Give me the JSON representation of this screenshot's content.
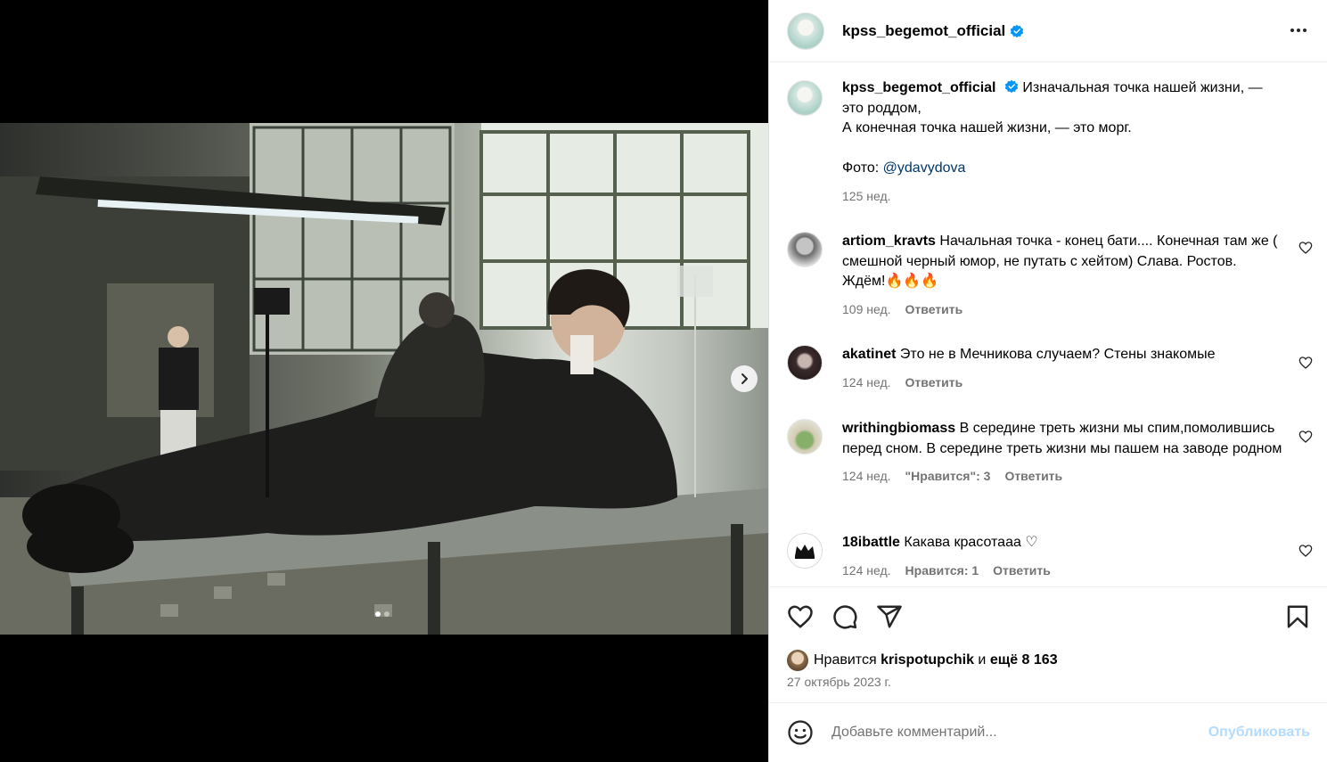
{
  "post": {
    "username": "kpss_begemot_official",
    "verified": true
  },
  "caption": {
    "username": "kpss_begemot_official",
    "line1": "Изначальная точка нашей жизни, —",
    "line2": "это роддом,",
    "line3": "А конечная точка нашей жизни, — это морг.",
    "photo_label": "Фото: ",
    "photo_mention": "@ydavydova",
    "time": "125 нед."
  },
  "comments": [
    {
      "username": "artiom_kravts",
      "text": "Начальная точка - конец бати.... Конечная там же ( смешной черный юмор, не путать с хейтом) Слава. Ростов. Ждём!🔥🔥🔥",
      "time": "109 нед.",
      "reply": "Ответить"
    },
    {
      "username": "akatinet",
      "text": "Это не в Мечникова случаем? Стены знакомые",
      "time": "124 нед.",
      "reply": "Ответить"
    },
    {
      "username": "writhingbiomass",
      "text": "В середине треть жизни мы спим,помолившись перед сном. В середине треть жизни мы пашем на заводе родном",
      "time": "124 нед.",
      "likes": "\"Нравится\": 3",
      "reply": "Ответить"
    },
    {
      "username": "18ibattle",
      "text": "Какава красотааа ♡",
      "time": "124 нед.",
      "likes": "Нравится: 1",
      "reply": "Ответить"
    }
  ],
  "likes": {
    "prefix": "Нравится",
    "user": "krispotupchik",
    "middle": "и",
    "rest": "ещё 8 163"
  },
  "date": "27 октябрь 2023 г.",
  "add_comment": {
    "placeholder": "Добавьте комментарий...",
    "publish": "Опубликовать"
  },
  "carousel": {
    "current": 1,
    "total": 2
  }
}
